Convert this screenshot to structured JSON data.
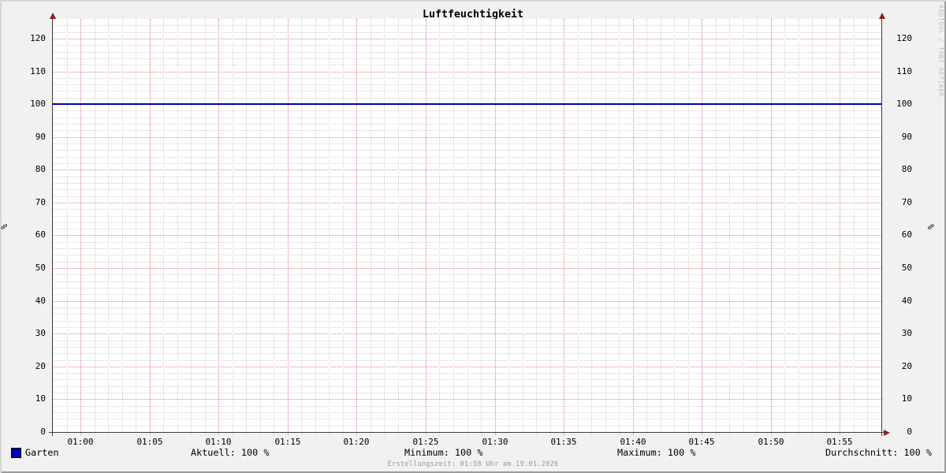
{
  "title": "Luftfeuchtigkeit",
  "watermark": "RRDTOOL / TOBI OETIKER",
  "y_axis": {
    "unit_left": "%",
    "unit_right": "%"
  },
  "legend": {
    "series_label": "Garten",
    "series_color": "#0000b4",
    "stats": [
      {
        "name": "aktuell",
        "text": "Aktuell: 100 %"
      },
      {
        "name": "minimum",
        "text": "Minimum: 100 %"
      },
      {
        "name": "maximum",
        "text": "Maximum: 100 %"
      },
      {
        "name": "durchschnitt",
        "text": "Durchschnitt: 100 %"
      }
    ]
  },
  "footer": "Erstellungszeit: 01:58 Uhr am 19.01.2026",
  "chart_data": {
    "type": "line",
    "title": "Luftfeuchtigkeit",
    "xlabel": "",
    "ylabel": "%",
    "x_tick_labels": [
      "01:00",
      "01:05",
      "01:10",
      "01:15",
      "01:20",
      "01:25",
      "01:30",
      "01:35",
      "01:40",
      "01:45",
      "01:50",
      "01:55"
    ],
    "y_tick_values": [
      0,
      10,
      20,
      30,
      40,
      50,
      60,
      70,
      80,
      90,
      100,
      110,
      120
    ],
    "ylim": [
      0,
      126
    ],
    "x_range_minutes": 60,
    "x_start_label": "00:58",
    "x_end_label": "01:58",
    "first_major_offset_min": 2,
    "major_x_step_min": 5,
    "minor_x_step_min": 1,
    "major_y_step": 10,
    "minor_y_step": 2,
    "grid": true,
    "legend_position": "bottom",
    "series": [
      {
        "name": "Garten",
        "color": "#0000b4",
        "constant_value": 100,
        "x": [
          "01:00",
          "01:05",
          "01:10",
          "01:15",
          "01:20",
          "01:25",
          "01:30",
          "01:35",
          "01:40",
          "01:45",
          "01:50",
          "01:55"
        ],
        "values": [
          100,
          100,
          100,
          100,
          100,
          100,
          100,
          100,
          100,
          100,
          100,
          100
        ]
      }
    ],
    "stats": {
      "aktuell": 100,
      "minimum": 100,
      "maximum": 100,
      "durchschnitt": 100,
      "unit": "%"
    }
  }
}
